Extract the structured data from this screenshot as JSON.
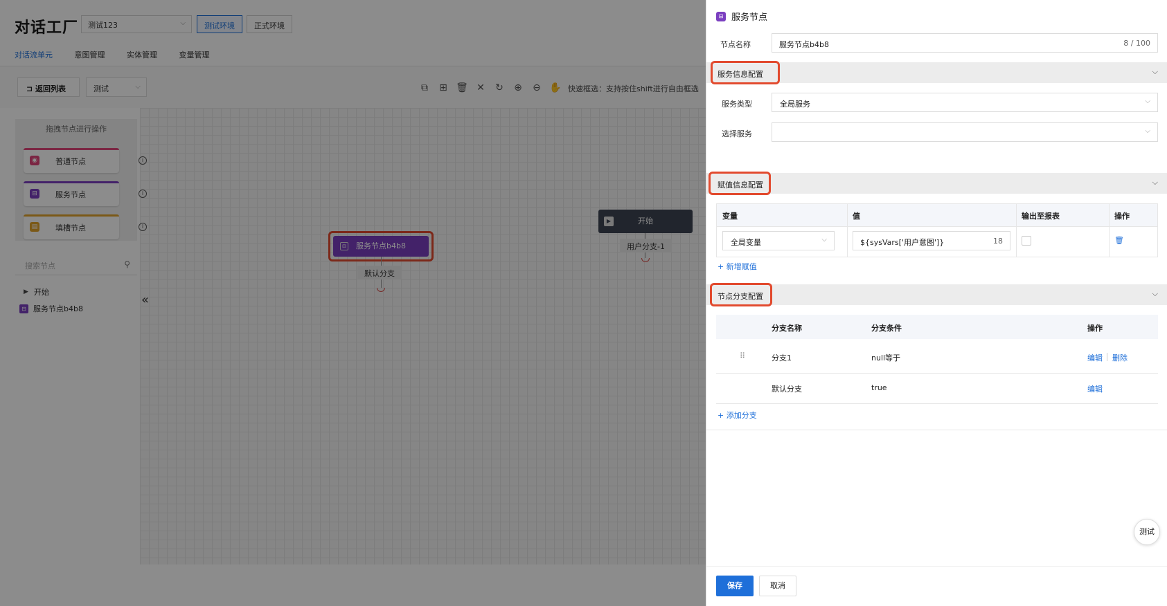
{
  "app": {
    "title": "对话工厂",
    "project_select": "测试123",
    "env_buttons": [
      {
        "label": "测试环境",
        "active": true
      },
      {
        "label": "正式环境",
        "active": false
      }
    ],
    "tabs": [
      {
        "label": "对话流单元",
        "active": true
      },
      {
        "label": "意图管理",
        "active": false
      },
      {
        "label": "实体管理",
        "active": false
      },
      {
        "label": "变量管理",
        "active": false
      }
    ]
  },
  "toolbar": {
    "back_label": "返回列表",
    "mode_select": "测试",
    "hint": "快速框选：支持按住shift进行自由框选"
  },
  "palette": {
    "title": "拖拽节点进行操作",
    "items": [
      {
        "label": "普通节点",
        "color": "#e0457b"
      },
      {
        "label": "服务节点",
        "color": "#7b3fc0"
      },
      {
        "label": "填槽节点",
        "color": "#e0a22a"
      }
    ]
  },
  "node_search": {
    "placeholder": "搜索节点"
  },
  "tree": [
    {
      "label": "开始"
    },
    {
      "label": "服务节点b4b8"
    }
  ],
  "canvas": {
    "service_node": "服务节点b4b8",
    "service_branch": "默认分支",
    "start_node": "开始",
    "start_branch": "用户分支-1"
  },
  "drawer": {
    "title": "服务节点",
    "node_name_label": "节点名称",
    "node_name_value": "服务节点b4b8",
    "node_name_counter": "8 / 100",
    "service_section": {
      "title": "服务信息配置",
      "service_type_label": "服务类型",
      "service_type_value": "全局服务",
      "select_service_label": "选择服务",
      "select_service_value": ""
    },
    "assign_section": {
      "title": "赋值信息配置",
      "columns": [
        "变量",
        "值",
        "输出至报表",
        "操作"
      ],
      "rows": [
        {
          "variable": "全局变量",
          "value": "${sysVars['用户意图']}",
          "value_count": "18"
        }
      ],
      "add_label": "+ 新增赋值"
    },
    "branch_section": {
      "title": "节点分支配置",
      "columns": [
        "分支名称",
        "分支条件",
        "操作"
      ],
      "rows": [
        {
          "name": "分支1",
          "condition": "null等于",
          "edit": "编辑",
          "delete": "删除"
        },
        {
          "name": "默认分支",
          "condition": "true",
          "edit": "编辑"
        }
      ],
      "add_label": "+ 添加分支"
    },
    "save_label": "保存",
    "cancel_label": "取消",
    "float_test_label": "测试"
  }
}
